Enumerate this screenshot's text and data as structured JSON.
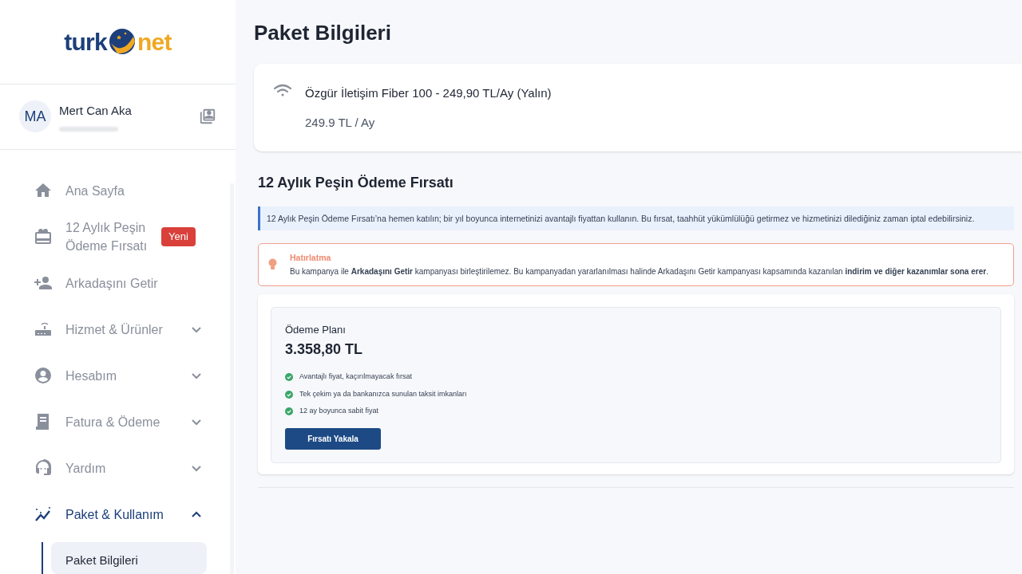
{
  "logo": {
    "left": "turk",
    "right": "net"
  },
  "user": {
    "initials": "MA",
    "name": "Mert Can Aka"
  },
  "menu": [
    {
      "label": "Ana Sayfa"
    },
    {
      "label": "12 Aylık Peşin Ödeme Fırsatı",
      "badge": "Yeni"
    },
    {
      "label": "Arkadaşını Getir"
    },
    {
      "label": "Hizmet & Ürünler",
      "expanded": false
    },
    {
      "label": "Hesabım",
      "expanded": false
    },
    {
      "label": "Fatura & Ödeme",
      "expanded": false
    },
    {
      "label": "Yardım",
      "expanded": false
    },
    {
      "label": "Paket & Kullanım",
      "expanded": true,
      "children": [
        {
          "label": "Paket Bilgileri",
          "selected": true
        }
      ]
    }
  ],
  "page_title": "Paket Bilgileri",
  "package": {
    "name": "Özgür İletişim Fiber 100 - 249,90 TL/Ay (Yalın)",
    "price": "249.9 TL / Ay"
  },
  "offer": {
    "title": "12 Aylık Peşin Ödeme Fırsatı",
    "info": "12 Aylık Peşin Ödeme Fırsatı’na hemen katılın; bir yıl boyunca internetinizi avantajlı fiyattan kullanın. Bu fırsat, taahhüt yükümlülüğü getirmez ve hizmetinizi dilediğiniz zaman iptal edebilirsiniz.",
    "reminder_title": "Hatırlatma",
    "reminder_text": "Bu kampanya ile **Arkadaşını Getir** kampanyası birleştirilemez. Bu kampanyadan yararlanılması halinde Arkadaşını Getir kampanyası kapsamında kazanılan **indirim ve diğer kazanımlar sona erer**.",
    "plan_label": "Ödeme Planı",
    "plan_price": "3.358,80 TL",
    "features": [
      "Avantajlı fiyat, kaçırılmayacak fırsat",
      "Tek çekim ya da bankanızca sunulan taksit imkanları",
      "12 ay boyunca sabit fiyat"
    ],
    "button": "Fırsatı Yakala"
  }
}
